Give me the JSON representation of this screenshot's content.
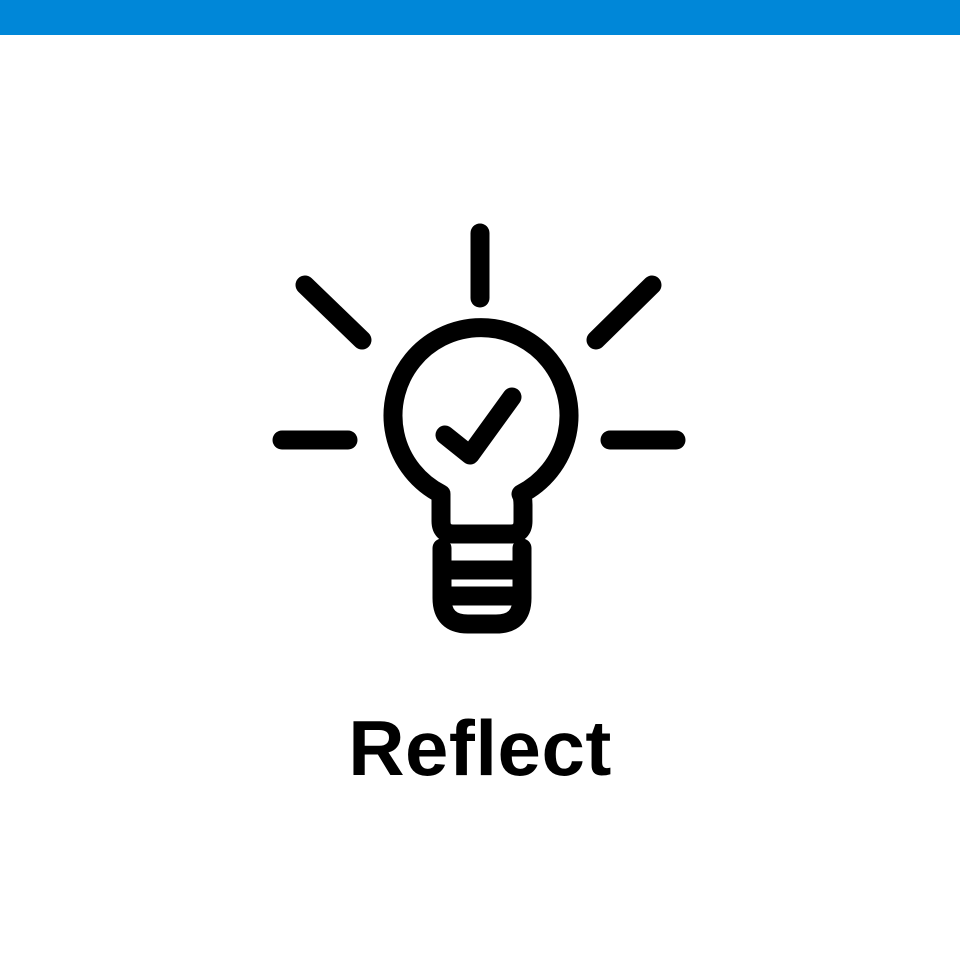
{
  "colors": {
    "top_bar": "#0087D8",
    "icon": "#000000",
    "background": "#FFFFFF",
    "caption": "#000000"
  },
  "icon": {
    "name": "lightbulb-check-icon"
  },
  "caption": {
    "text": "Reflect"
  }
}
